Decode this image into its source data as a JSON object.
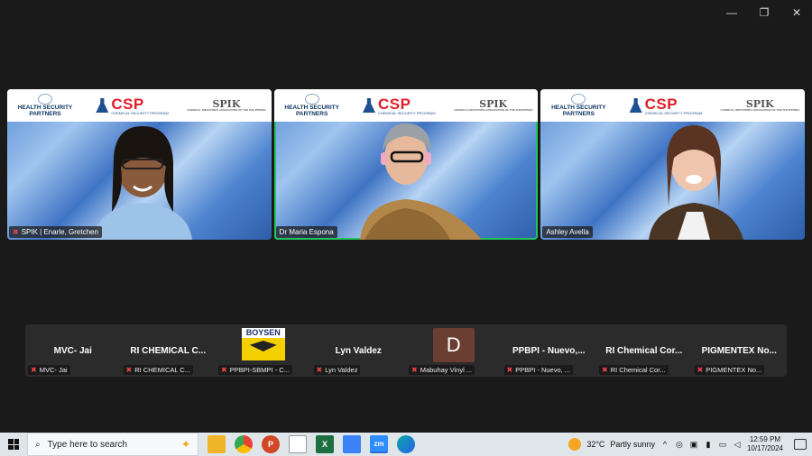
{
  "window": {
    "controls": [
      "—",
      "❐",
      "✕"
    ]
  },
  "banner": {
    "hsp_line1": "HEALTH SECURITY",
    "hsp_line2": "PARTNERS",
    "csp": "CSP",
    "csp_sub": "CHEMICAL SECURITY PROGRAM",
    "spik": "SPIK",
    "spik_sub": "CHEMICAL INDUSTRIES ASSOCIATION OF THE PHILIPPINES"
  },
  "tiles": [
    {
      "name": "SPIK | Enarle, Gretchen",
      "muted": true,
      "active": false
    },
    {
      "name": "Dr Maria Espona",
      "muted": false,
      "active": true
    },
    {
      "name": "Ashley Avella",
      "muted": false,
      "active": false
    }
  ],
  "participants": [
    {
      "display": "MVC- Jai",
      "tag": "MVC- Jai",
      "kind": "text"
    },
    {
      "display": "RI CHEMICAL C...",
      "tag": "RI CHEMICAL C...",
      "kind": "text"
    },
    {
      "display": "BOYSEN",
      "tag": "PPBPI-SBMPI - C...",
      "kind": "logo"
    },
    {
      "display": "Lyn Valdez",
      "tag": "Lyn Valdez",
      "kind": "text"
    },
    {
      "display": "D",
      "tag": "Mabuhay Vinyl ...",
      "kind": "avatar"
    },
    {
      "display": "PPBPI - Nuevo,...",
      "tag": "PPBPI - Nuevo, ...",
      "kind": "text"
    },
    {
      "display": "RI Chemical Cor...",
      "tag": "RI Chemical Cor...",
      "kind": "text"
    },
    {
      "display": "PIGMENTEX No...",
      "tag": "PIGMENTEX No...",
      "kind": "text"
    }
  ],
  "taskbar": {
    "search_placeholder": "Type here to search",
    "apps": [
      {
        "name": "file-explorer",
        "label": "",
        "color": "#f0b429"
      },
      {
        "name": "chrome",
        "label": "",
        "color": "#34a853"
      },
      {
        "name": "powerpoint",
        "label": "P",
        "color": "#d24726"
      },
      {
        "name": "notepad",
        "label": "",
        "color": "#ffffff"
      },
      {
        "name": "excel",
        "label": "X",
        "color": "#1d6f42"
      },
      {
        "name": "snipping-tool",
        "label": "",
        "color": "#3b82f6"
      },
      {
        "name": "zoom",
        "label": "zm",
        "color": "#2d8cff"
      },
      {
        "name": "edge",
        "label": "",
        "color": "#0ea5a5"
      }
    ],
    "weather": "32°C",
    "weather_desc": "Partly sunny",
    "time": "12:59 PM",
    "date": "10/17/2024"
  }
}
